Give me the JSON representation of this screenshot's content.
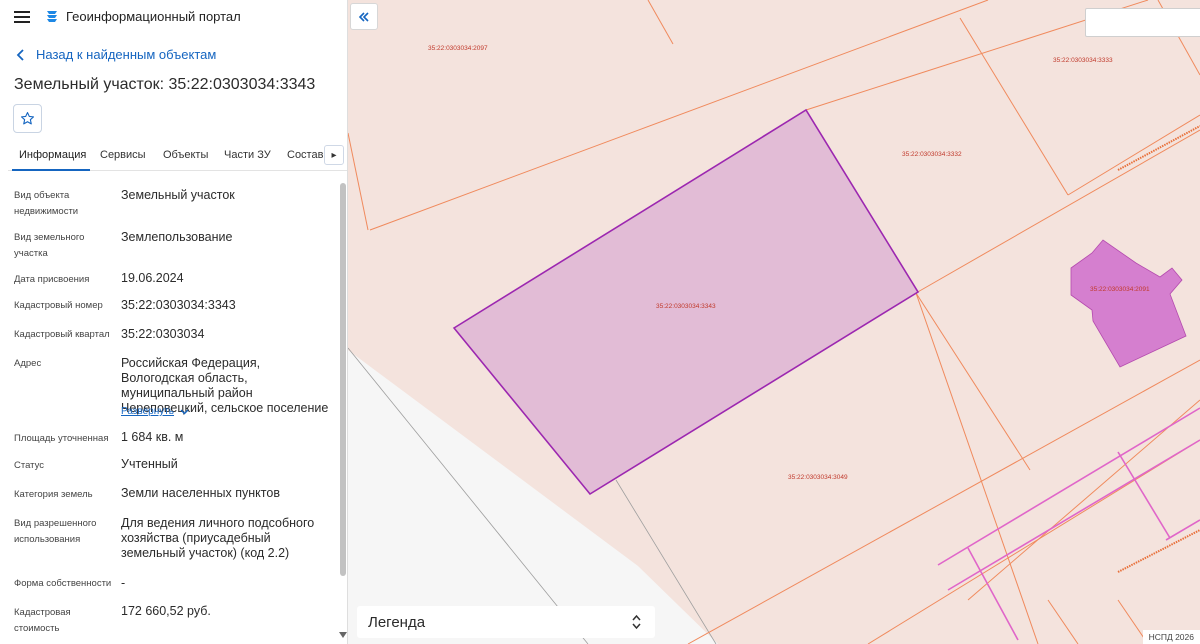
{
  "header": {
    "title": "Геоинформационный портал",
    "menu_icon": "hamburger-icon",
    "logo_icon": "portal-logo-icon"
  },
  "back_link": "Назад к найденным объектам",
  "page_title": "Земельный участок: 35:22:0303034:3343",
  "favorite_icon": "star-icon",
  "tabs": [
    {
      "label": "Информация",
      "active": true
    },
    {
      "label": "Сервисы"
    },
    {
      "label": "Объекты"
    },
    {
      "label": "Части ЗУ"
    },
    {
      "label": "Состав"
    }
  ],
  "tabs_next_icon": "chevron-right-icon",
  "info": [
    {
      "label": "Вид объекта недвижимости",
      "value": "Земельный участок"
    },
    {
      "label": "Вид земельного участка",
      "value": "Землепользование"
    },
    {
      "label": "Дата присвоения",
      "value": "19.06.2024"
    },
    {
      "label": "Кадастровый номер",
      "value": "35:22:0303034:3343"
    },
    {
      "label": "Кадастровый квартал",
      "value": "35:22:0303034"
    },
    {
      "label": "Адрес",
      "value": "Российская Федерация, Вологодская область, муниципальный район Череповецкий, сельское поселение"
    },
    {
      "label": "Площадь уточненная",
      "value": "1 684 кв. м"
    },
    {
      "label": "Статус",
      "value": "Учтенный"
    },
    {
      "label": "Категория земель",
      "value": "Земли населенных пунктов"
    },
    {
      "label": "Вид разрешенного использования",
      "value": "Для ведения личного подсобного хозяйства (приусадебный земельный участок) (код 2.2)"
    },
    {
      "label": "Форма собственности",
      "value": "-"
    },
    {
      "label": "Кадастровая стоимость",
      "value": "172 660,52 руб."
    }
  ],
  "expand_link": "Развернуть",
  "map": {
    "parcels": [
      {
        "id": "35:22:0303034:2097"
      },
      {
        "id": "35:22:0303034:3333"
      },
      {
        "id": "35:22:0303034:3332"
      },
      {
        "id": "35:22:0303034:3343",
        "selected": true
      },
      {
        "id": "35:22:0303034:2091"
      },
      {
        "id": "35:22:0303034:3049"
      }
    ],
    "legend": "Легенда",
    "copyright": "НСПД 2026",
    "colors": {
      "background": "#f4e3dd",
      "boundary": "#f08a5d",
      "selected_fill": "#e2bcd6",
      "selected_stroke": "#9c27b0",
      "building": "#d57fcf",
      "road": "#e066c9"
    }
  }
}
